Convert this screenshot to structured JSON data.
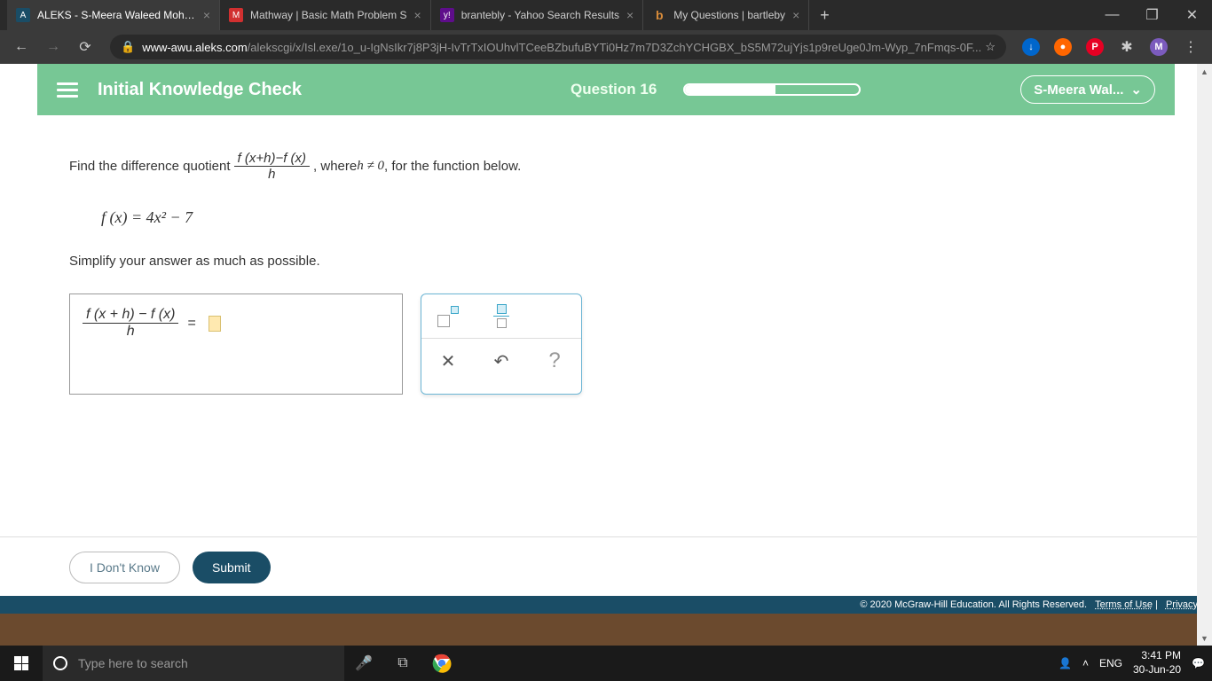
{
  "tabs": [
    {
      "title": "ALEKS - S-Meera Waleed Moham",
      "favicon_bg": "#1a4d66",
      "favicon_txt": "A",
      "favicon_color": "#fff"
    },
    {
      "title": "Mathway | Basic Math Problem S",
      "favicon_bg": "#d13030",
      "favicon_txt": "M",
      "favicon_color": "#fff"
    },
    {
      "title": "brantebly - Yahoo Search Results",
      "favicon_bg": "#5e0d8b",
      "favicon_txt": "y!",
      "favicon_color": "#fff"
    },
    {
      "title": "My Questions | bartleby",
      "favicon_bg": "transparent",
      "favicon_txt": "b",
      "favicon_color": "#d98c3a"
    }
  ],
  "url": {
    "domain": "www-awu.aleks.com",
    "path": "/alekscgi/x/Isl.exe/1o_u-IgNsIkr7j8P3jH-IvTrTxIOUhvlTCeeBZbufuBYTi0Hz7m7D3ZchYCHGBX_bS5M72ujYjs1p9reUge0Jm-Wyp_7nFmqs-0F..."
  },
  "header": {
    "title": "Initial Knowledge Check",
    "question": "Question 16",
    "user": "S-Meera Wal..."
  },
  "problem": {
    "prompt_pre": "Find the difference quotient ",
    "frac_num": "f (x+h)−f (x)",
    "frac_den": "h",
    "prompt_mid": ", where ",
    "condition": "h ≠ 0",
    "prompt_post": ", for the function below.",
    "func": "f (x) = 4x² − 7",
    "simplify": "Simplify your answer as much as possible.",
    "ans_num": "f (x + h) − f (x)",
    "ans_den": "h",
    "equals": "="
  },
  "tools": {
    "clear": "✕",
    "undo": "↶",
    "help": "?"
  },
  "footer": {
    "dont_know": "I Don't Know",
    "submit": "Submit",
    "copyright": "© 2020 McGraw-Hill Education. All Rights Reserved.",
    "terms": "Terms of Use",
    "privacy": "Privacy"
  },
  "taskbar": {
    "search_placeholder": "Type here to search",
    "lang": "ENG",
    "time": "3:41 PM",
    "date": "30-Jun-20"
  }
}
